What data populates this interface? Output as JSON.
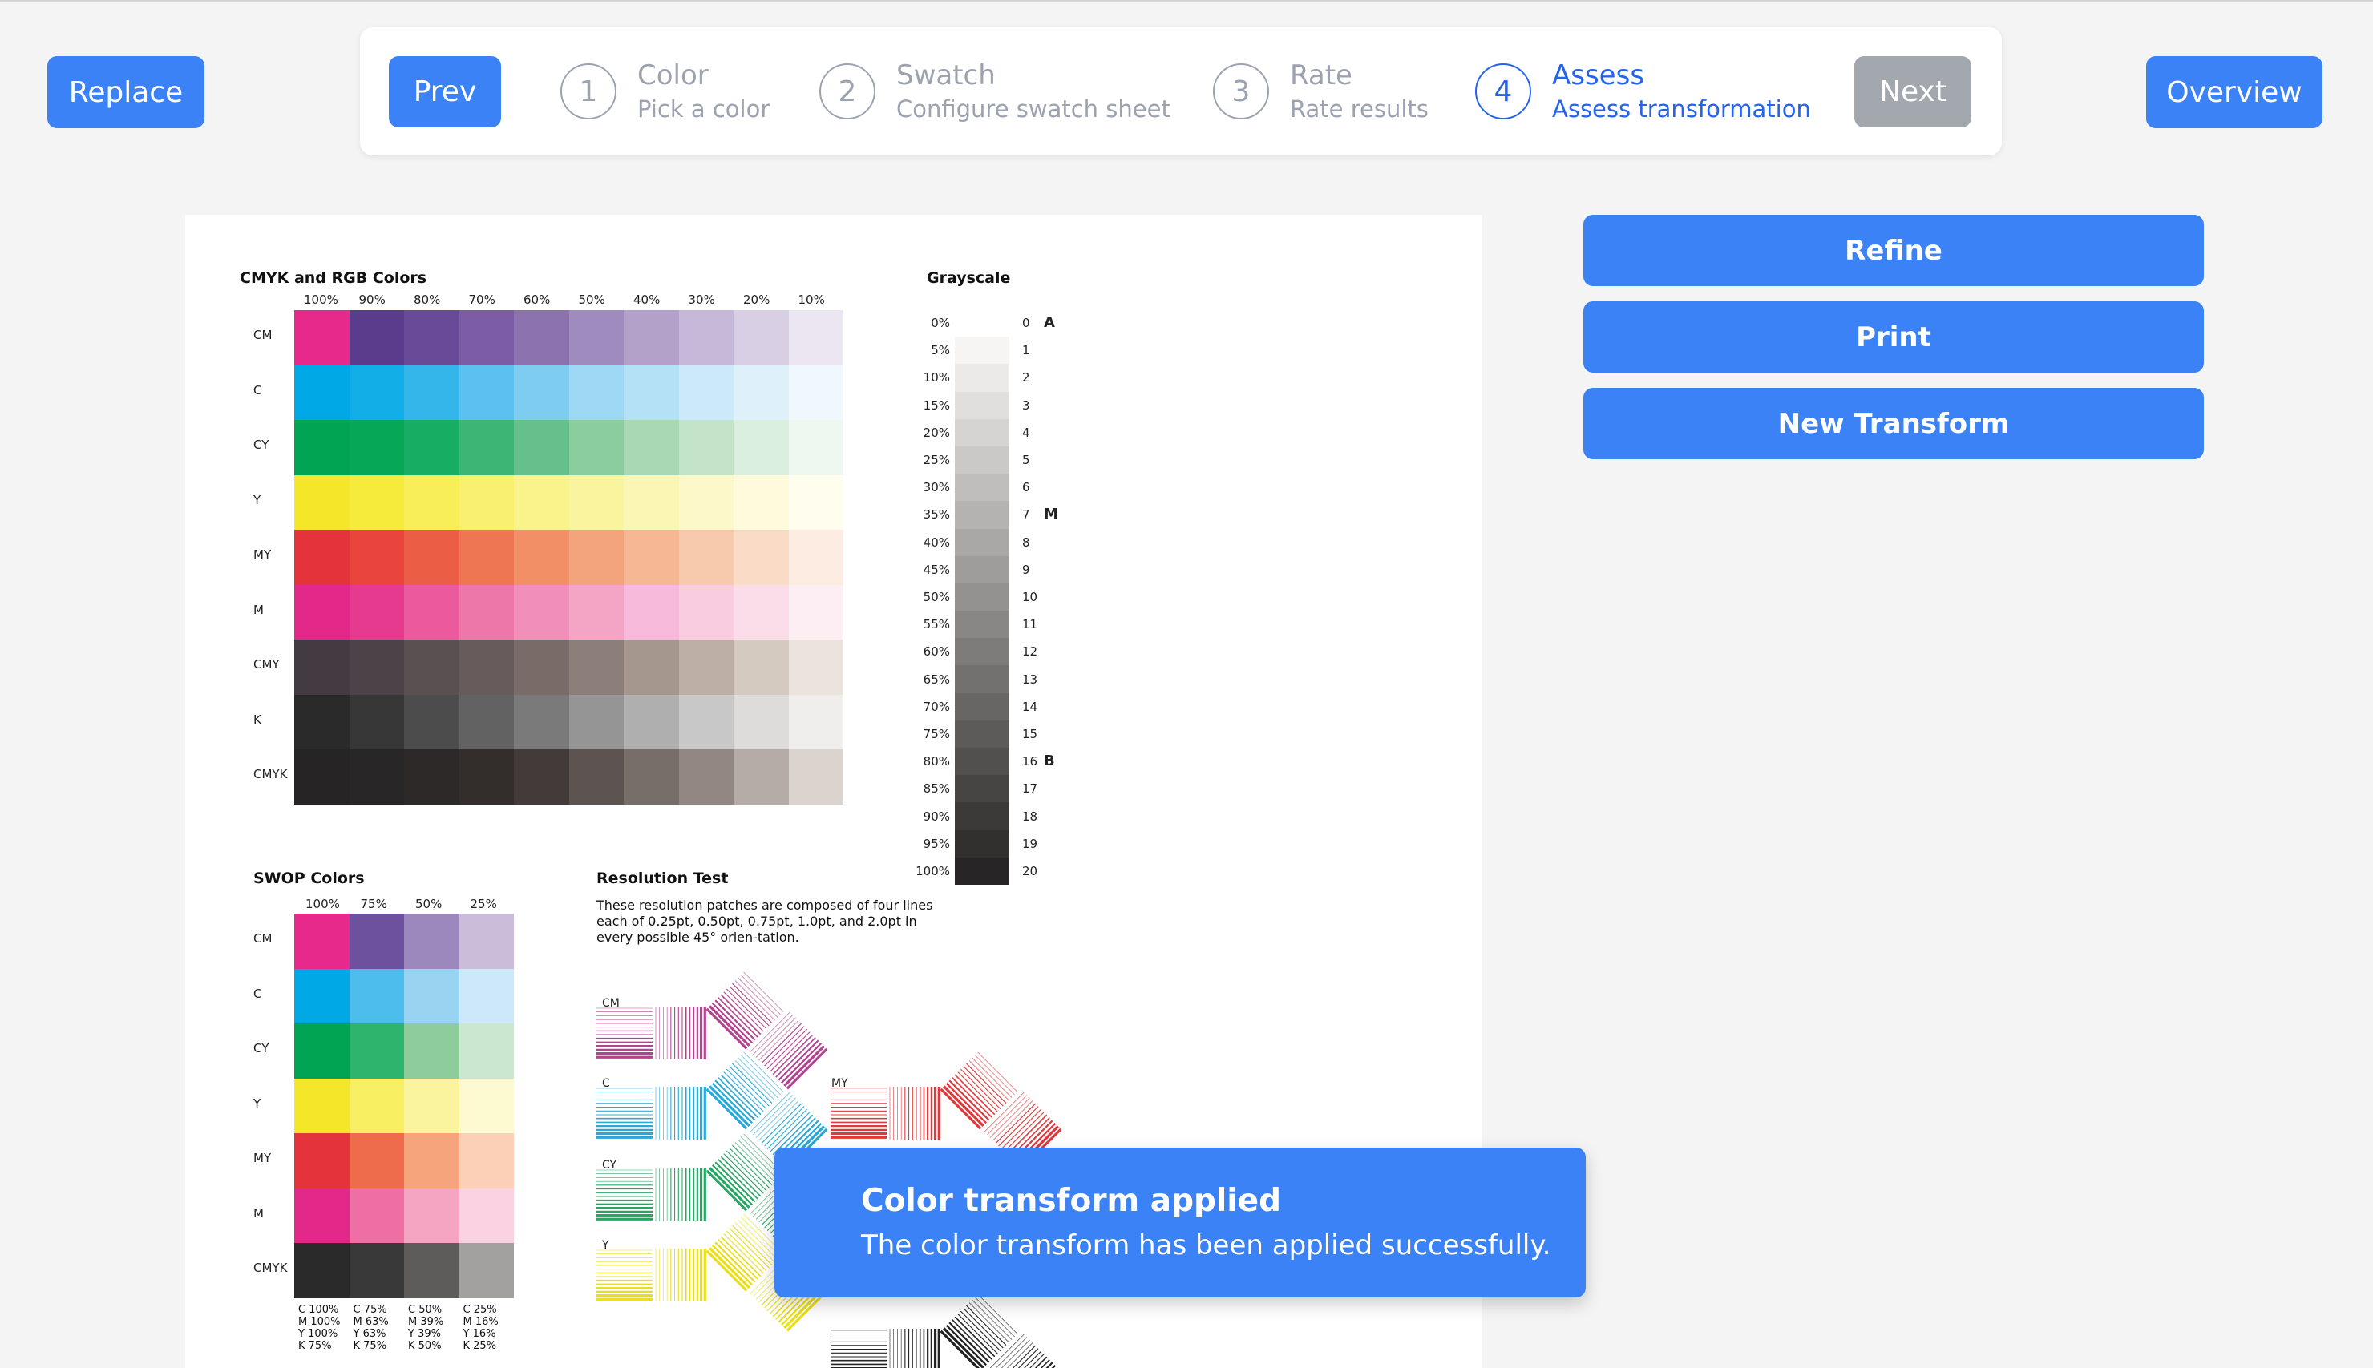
{
  "header": {
    "replace_label": "Replace",
    "overview_label": "Overview",
    "prev_label": "Prev",
    "next_label": "Next",
    "steps": [
      {
        "num": "1",
        "title": "Color",
        "subtitle": "Pick a color",
        "active": false
      },
      {
        "num": "2",
        "title": "Swatch",
        "subtitle": "Configure swatch sheet",
        "active": false
      },
      {
        "num": "3",
        "title": "Rate",
        "subtitle": "Rate results",
        "active": false
      },
      {
        "num": "4",
        "title": "Assess",
        "subtitle": "Assess transformation",
        "active": true
      }
    ]
  },
  "actions": {
    "refine_label": "Refine",
    "print_label": "Print",
    "new_transform_label": "New Transform"
  },
  "toast": {
    "title": "Color transform applied",
    "message": "The color transform has been applied successfully."
  },
  "sheet": {
    "cmyk_title": "CMYK and RGB Colors",
    "cmyk_columns": [
      "100%",
      "90%",
      "80%",
      "70%",
      "60%",
      "50%",
      "40%",
      "30%",
      "20%",
      "10%"
    ],
    "cmyk_rows": [
      {
        "label": "CM",
        "colors": [
          "#e6298b",
          "#5b3b8c",
          "#684a98",
          "#7c5ca4",
          "#8d72b0",
          "#9f8bbd",
          "#b3a1ca",
          "#c6b8d8",
          "#d9cfe5",
          "#ece6f2"
        ]
      },
      {
        "label": "C",
        "colors": [
          "#00a8e6",
          "#12aee8",
          "#35b6ea",
          "#5cc1ee",
          "#7ecdf1",
          "#9dd8f4",
          "#b5e1f6",
          "#cbe9f8",
          "#def1fb",
          "#eff8fd"
        ]
      },
      {
        "label": "CY",
        "colors": [
          "#00a453",
          "#06a757",
          "#17ae63",
          "#3db574",
          "#66c08b",
          "#8bcd9f",
          "#a9d8b5",
          "#c4e4ca",
          "#dbefdf",
          "#eef7f0"
        ]
      },
      {
        "label": "Y",
        "colors": [
          "#f4e72a",
          "#f6eb3a",
          "#f8ee58",
          "#f9f072",
          "#faf28a",
          "#fbf49e",
          "#fcf6b4",
          "#fdf8c9",
          "#fefadb",
          "#fffded"
        ]
      },
      {
        "label": "MY",
        "colors": [
          "#e4333a",
          "#e9453c",
          "#ec5d45",
          "#ef7652",
          "#f28f67",
          "#f4a47c",
          "#f6b894",
          "#f8caad",
          "#fadbc6",
          "#fdece2"
        ]
      },
      {
        "label": "M",
        "colors": [
          "#e2298a",
          "#e63a8f",
          "#ea5a9c",
          "#ee77aa",
          "#f18fb8",
          "#f4a5c5",
          "#f7badb",
          "#f9ccdf",
          "#fbdde9",
          "#fdeef4"
        ]
      },
      {
        "label": "CMY",
        "colors": [
          "#433a42",
          "#4c4247",
          "#5a4f51",
          "#675c5b",
          "#786b68",
          "#8c7e78",
          "#a5968e",
          "#bdafa5",
          "#d5cac0",
          "#ebe4dd"
        ]
      },
      {
        "label": "K",
        "colors": [
          "#2b2a2a",
          "#383737",
          "#4d4c4c",
          "#636262",
          "#7b7a7a",
          "#969595",
          "#b0afaf",
          "#c9c8c8",
          "#dedcdb",
          "#efeeed"
        ]
      },
      {
        "label": "CMYK",
        "colors": [
          "#262425",
          "#292627",
          "#2d2929",
          "#332d2c",
          "#433b39",
          "#5d5451",
          "#776d69",
          "#938784",
          "#b5aba7",
          "#dbd3ce"
        ]
      }
    ],
    "grayscale_title": "Grayscale",
    "grayscale_pct": [
      "0%",
      "5%",
      "10%",
      "15%",
      "20%",
      "25%",
      "30%",
      "35%",
      "40%",
      "45%",
      "50%",
      "55%",
      "60%",
      "65%",
      "70%",
      "75%",
      "80%",
      "85%",
      "90%",
      "95%",
      "100%"
    ],
    "grayscale_idx": [
      "0",
      "1",
      "2",
      "3",
      "4",
      "5",
      "6",
      "7",
      "8",
      "9",
      "10",
      "11",
      "12",
      "13",
      "14",
      "15",
      "16",
      "17",
      "18",
      "19",
      "20"
    ],
    "grayscale_colors": [
      "#ffffff",
      "#f6f5f4",
      "#ebeae8",
      "#e1dfdd",
      "#d6d4d2",
      "#cbc9c7",
      "#c0bebc",
      "#b5b3b1",
      "#aaa8a6",
      "#9f9d9b",
      "#949290",
      "#898785",
      "#7e7c7a",
      "#73716f",
      "#686664",
      "#5d5b59",
      "#52504e",
      "#474543",
      "#3c3a39",
      "#32302f",
      "#272525"
    ],
    "grayscale_markers": [
      {
        "at": 0,
        "text": "A"
      },
      {
        "at": 7,
        "text": "M"
      },
      {
        "at": 16,
        "text": "B"
      }
    ],
    "swop_title": "SWOP Colors",
    "swop_columns": [
      "100%",
      "75%",
      "50%",
      "25%"
    ],
    "swop_rows": [
      {
        "label": "CM",
        "colors": [
          "#e6298b",
          "#6e519e",
          "#9c88bd",
          "#cbbdd9"
        ]
      },
      {
        "label": "C",
        "colors": [
          "#00a8e6",
          "#4cbdec",
          "#98d3f2",
          "#cde8f9"
        ]
      },
      {
        "label": "CY",
        "colors": [
          "#00a453",
          "#2fb46e",
          "#8fcc9c",
          "#cbe7cf"
        ]
      },
      {
        "label": "Y",
        "colors": [
          "#f4e72a",
          "#f8ef62",
          "#fbf49e",
          "#fdf9d0"
        ]
      },
      {
        "label": "MY",
        "colors": [
          "#e4333a",
          "#ee6c4c",
          "#f5a47c",
          "#fbd0b6"
        ]
      },
      {
        "label": "M",
        "colors": [
          "#e2298a",
          "#ef6fa4",
          "#f5a4c2",
          "#fbd2e1"
        ]
      },
      {
        "label": "CMYK",
        "colors": [
          "#2b2a2a",
          "#3a3939",
          "#5d5c5b",
          "#a2a1a0"
        ]
      }
    ],
    "swop_captions": [
      "C 100%\nM 100%\nY 100%\nK 75%",
      "C 75%\nM 63%\nY 63%\nK 75%",
      "C 50%\nM 39%\nY 39%\nK 50%",
      "C 25%\nM 16%\nY 16%\nK 25%"
    ],
    "res_title": "Resolution Test",
    "res_text": "These resolution patches are composed of four lines each of 0.25pt, 0.50pt, 0.75pt, 1.0pt, and 2.0pt in every possible 45° orien-tation.",
    "res_patches": [
      {
        "label": "CM",
        "color": "#b2448f"
      },
      {
        "label": "C",
        "color": "#29a8d8"
      },
      {
        "label": "CY",
        "color": "#2aa566"
      },
      {
        "label": "Y",
        "color": "#e8de1a"
      },
      {
        "label": "MY",
        "color": "#e0383b"
      },
      {
        "label": "",
        "color": "#222222"
      }
    ]
  }
}
